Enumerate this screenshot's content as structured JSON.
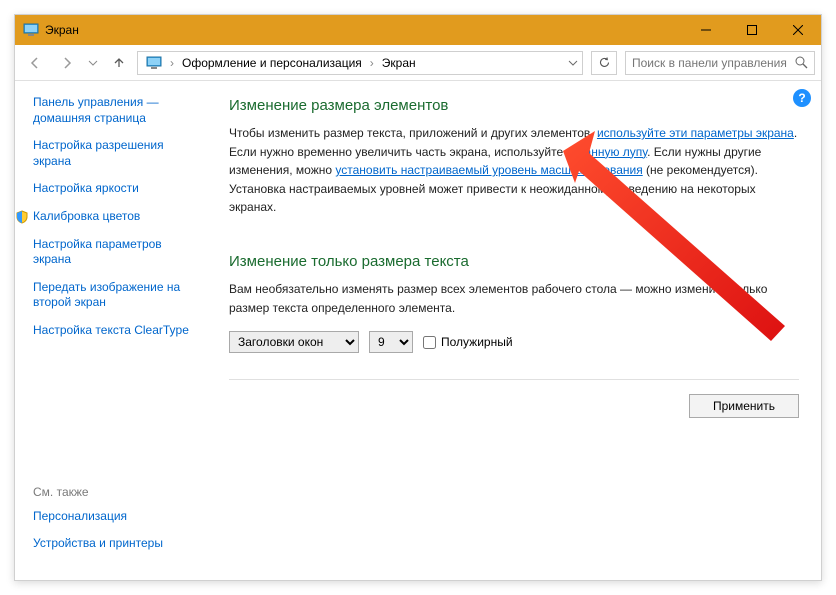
{
  "window": {
    "title": "Экран"
  },
  "breadcrumb": {
    "item1": "Оформление и персонализация",
    "item2": "Экран"
  },
  "search": {
    "placeholder": "Поиск в панели управления"
  },
  "sidebar": {
    "home": "Панель управления — домашняя страница",
    "items": [
      "Настройка разрешения экрана",
      "Настройка яркости",
      "Калибровка цветов",
      "Настройка параметров экрана",
      "Передать изображение на второй экран",
      "Настройка текста ClearType"
    ]
  },
  "seealso": {
    "heading": "См. также",
    "items": [
      "Персонализация",
      "Устройства и принтеры"
    ]
  },
  "section1": {
    "heading": "Изменение размера элементов",
    "t1": "Чтобы изменить размер текста, приложений и других элементов, ",
    "link1": "используйте эти параметры экрана",
    "t2": ". Если нужно временно увеличить часть экрана, используйте ",
    "link2": "экранную лупу",
    "t3": ". Если нужны другие изменения, можно ",
    "link3": "установить настраиваемый уровень масштабирования",
    "t4": " (не рекомендуется). Установка настраиваемых уровней может привести к неожиданному поведению на некоторых экранах."
  },
  "section2": {
    "heading": "Изменение только размера текста",
    "para": "Вам необязательно изменять размер всех элементов рабочего стола — можно изменить только размер текста определенного элемента.",
    "select_element": "Заголовки окон",
    "select_size": "9",
    "bold_label": "Полужирный"
  },
  "apply": "Применить"
}
